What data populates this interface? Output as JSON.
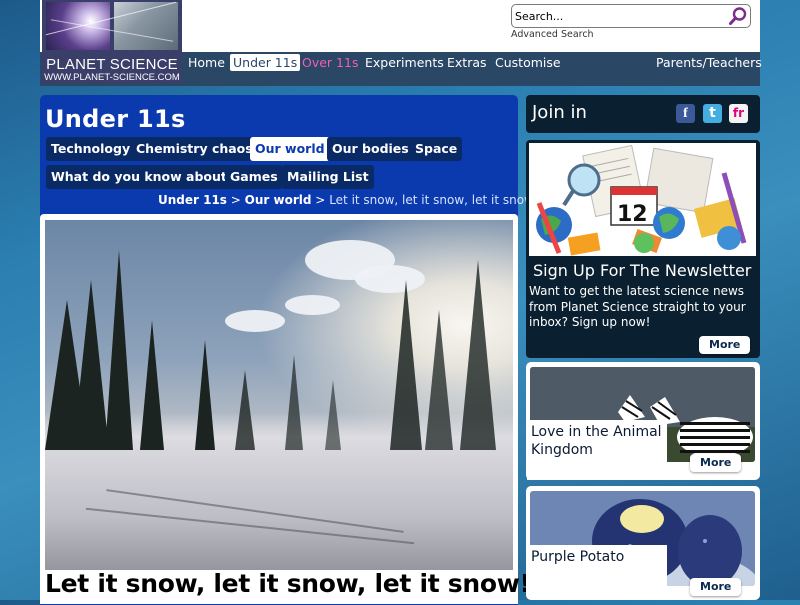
{
  "header": {
    "logo_title": "PLANET SCIENCE",
    "logo_url": "WWW.PLANET-SCIENCE.COM",
    "search_placeholder": "Search...",
    "advanced_search": "Advanced Search"
  },
  "nav": {
    "items": [
      {
        "label": "Home"
      },
      {
        "label": "Under 11s"
      },
      {
        "label": "Over 11s"
      },
      {
        "label": "Experiments"
      },
      {
        "label": "Extras"
      },
      {
        "label": "Customise"
      }
    ],
    "right": "Parents/Teachers"
  },
  "section": {
    "title": "Under 11s",
    "subnav": [
      {
        "label": "Technology"
      },
      {
        "label": "Chemistry chaos"
      },
      {
        "label": "Our world"
      },
      {
        "label": "Our bodies"
      },
      {
        "label": "Space"
      },
      {
        "label": "What do you know about?"
      },
      {
        "label": "Games"
      },
      {
        "label": "Mailing List"
      }
    ]
  },
  "breadcrumb": {
    "first": "Under 11s",
    "second": "Our world",
    "current": "Let it snow, let it snow, let it snow",
    "separator": ">"
  },
  "article": {
    "title": "Let it snow, let it snow, let it snow!"
  },
  "sidebar": {
    "join_in": "Join in",
    "newsletter": {
      "badge_number": "12",
      "title": "Sign Up For The Newsletter",
      "text": "Want to get the latest science news from Planet Science straight to your inbox? Sign up now!",
      "more": "More"
    },
    "cards": [
      {
        "title": "Love in the Animal Kingdom",
        "more": "More"
      },
      {
        "title": "Purple Potato",
        "more": "More"
      }
    ]
  },
  "colors": {
    "nav_bg": "#2a4766",
    "section_blue": "#0b3aaf",
    "pink_accent": "#f25db0",
    "dark_panel": "#0a2030"
  }
}
